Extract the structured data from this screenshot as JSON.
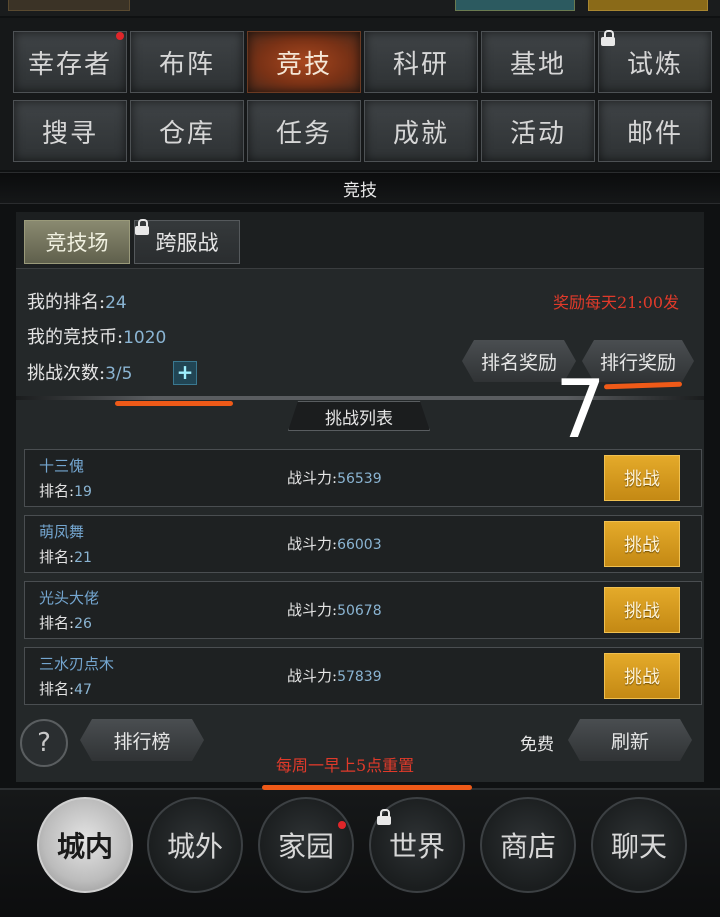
{
  "menu": {
    "items": [
      {
        "label": "幸存者",
        "badge": true,
        "locked": false,
        "active": false
      },
      {
        "label": "布阵",
        "badge": false,
        "locked": false,
        "active": false
      },
      {
        "label": "竞技",
        "badge": false,
        "locked": false,
        "active": true
      },
      {
        "label": "科研",
        "badge": false,
        "locked": false,
        "active": false
      },
      {
        "label": "基地",
        "badge": false,
        "locked": false,
        "active": false
      },
      {
        "label": "试炼",
        "badge": false,
        "locked": true,
        "active": false
      },
      {
        "label": "搜寻",
        "badge": false,
        "locked": false,
        "active": false
      },
      {
        "label": "仓库",
        "badge": false,
        "locked": false,
        "active": false
      },
      {
        "label": "任务",
        "badge": false,
        "locked": false,
        "active": false
      },
      {
        "label": "成就",
        "badge": false,
        "locked": false,
        "active": false
      },
      {
        "label": "活动",
        "badge": false,
        "locked": false,
        "active": false
      },
      {
        "label": "邮件",
        "badge": false,
        "locked": false,
        "active": false
      }
    ]
  },
  "section_title": "竞技",
  "tabs": {
    "arena": "竞技场",
    "cross_server": "跨服战"
  },
  "info": {
    "rank_label": "我的排名:",
    "rank_value": "24",
    "coins_label": "我的竞技币:",
    "coins_value": "1020",
    "attempts_label": "挑战次数:",
    "attempts_value": "3/5",
    "plus_symbol": "+",
    "reward_note": "奖励每天21:00发"
  },
  "buttons": {
    "rank_reward": "排名奖励",
    "ranking_reward": "排行奖励",
    "leaderboard": "排行榜",
    "refresh": "刷新",
    "help": "?",
    "free": "免费"
  },
  "challenge_list": {
    "title": "挑战列表",
    "rank_prefix": "排名:",
    "power_prefix": "战斗力:",
    "action_label": "挑战",
    "opponents": [
      {
        "name": "十三傀",
        "rank": "19",
        "power": "56539"
      },
      {
        "name": "萌凤舞",
        "rank": "21",
        "power": "66003"
      },
      {
        "name": "光头大佬",
        "rank": "26",
        "power": "50678"
      },
      {
        "name": "三水刃点木",
        "rank": "47",
        "power": "57839"
      }
    ]
  },
  "reset_note": "每周一早上5点重置",
  "annotation_number": "7",
  "bottom_nav": [
    {
      "label": "城内",
      "active": true,
      "badge": false,
      "locked": false
    },
    {
      "label": "城外",
      "active": false,
      "badge": false,
      "locked": false
    },
    {
      "label": "家园",
      "active": false,
      "badge": true,
      "locked": false
    },
    {
      "label": "世界",
      "active": false,
      "badge": false,
      "locked": true
    },
    {
      "label": "商店",
      "active": false,
      "badge": false,
      "locked": false
    },
    {
      "label": "聊天",
      "active": false,
      "badge": false,
      "locked": false
    }
  ],
  "colors": {
    "accent_orange": "#ef5a18",
    "highlight_red": "#e03a2a",
    "value_blue": "#8ab4d2",
    "challenge_gold": "#d99c1e",
    "active_tab_rust": "#a8471e"
  }
}
